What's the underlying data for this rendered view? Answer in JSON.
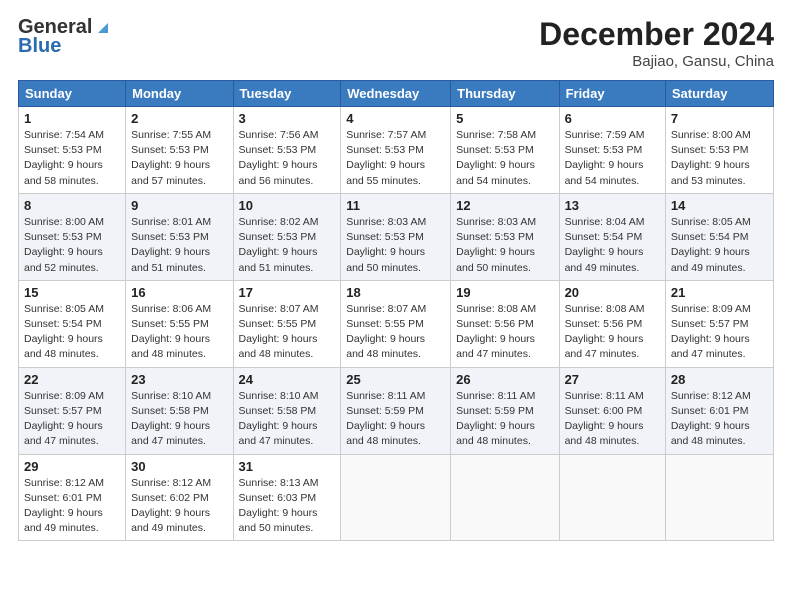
{
  "header": {
    "logo_general": "General",
    "logo_blue": "Blue",
    "month_title": "December 2024",
    "location": "Bajiao, Gansu, China"
  },
  "columns": [
    "Sunday",
    "Monday",
    "Tuesday",
    "Wednesday",
    "Thursday",
    "Friday",
    "Saturday"
  ],
  "weeks": [
    [
      {
        "day": "1",
        "sunrise": "7:54 AM",
        "sunset": "5:53 PM",
        "daylight": "9 hours and 58 minutes."
      },
      {
        "day": "2",
        "sunrise": "7:55 AM",
        "sunset": "5:53 PM",
        "daylight": "9 hours and 57 minutes."
      },
      {
        "day": "3",
        "sunrise": "7:56 AM",
        "sunset": "5:53 PM",
        "daylight": "9 hours and 56 minutes."
      },
      {
        "day": "4",
        "sunrise": "7:57 AM",
        "sunset": "5:53 PM",
        "daylight": "9 hours and 55 minutes."
      },
      {
        "day": "5",
        "sunrise": "7:58 AM",
        "sunset": "5:53 PM",
        "daylight": "9 hours and 54 minutes."
      },
      {
        "day": "6",
        "sunrise": "7:59 AM",
        "sunset": "5:53 PM",
        "daylight": "9 hours and 54 minutes."
      },
      {
        "day": "7",
        "sunrise": "8:00 AM",
        "sunset": "5:53 PM",
        "daylight": "9 hours and 53 minutes."
      }
    ],
    [
      {
        "day": "8",
        "sunrise": "8:00 AM",
        "sunset": "5:53 PM",
        "daylight": "9 hours and 52 minutes."
      },
      {
        "day": "9",
        "sunrise": "8:01 AM",
        "sunset": "5:53 PM",
        "daylight": "9 hours and 51 minutes."
      },
      {
        "day": "10",
        "sunrise": "8:02 AM",
        "sunset": "5:53 PM",
        "daylight": "9 hours and 51 minutes."
      },
      {
        "day": "11",
        "sunrise": "8:03 AM",
        "sunset": "5:53 PM",
        "daylight": "9 hours and 50 minutes."
      },
      {
        "day": "12",
        "sunrise": "8:03 AM",
        "sunset": "5:53 PM",
        "daylight": "9 hours and 50 minutes."
      },
      {
        "day": "13",
        "sunrise": "8:04 AM",
        "sunset": "5:54 PM",
        "daylight": "9 hours and 49 minutes."
      },
      {
        "day": "14",
        "sunrise": "8:05 AM",
        "sunset": "5:54 PM",
        "daylight": "9 hours and 49 minutes."
      }
    ],
    [
      {
        "day": "15",
        "sunrise": "8:05 AM",
        "sunset": "5:54 PM",
        "daylight": "9 hours and 48 minutes."
      },
      {
        "day": "16",
        "sunrise": "8:06 AM",
        "sunset": "5:55 PM",
        "daylight": "9 hours and 48 minutes."
      },
      {
        "day": "17",
        "sunrise": "8:07 AM",
        "sunset": "5:55 PM",
        "daylight": "9 hours and 48 minutes."
      },
      {
        "day": "18",
        "sunrise": "8:07 AM",
        "sunset": "5:55 PM",
        "daylight": "9 hours and 48 minutes."
      },
      {
        "day": "19",
        "sunrise": "8:08 AM",
        "sunset": "5:56 PM",
        "daylight": "9 hours and 47 minutes."
      },
      {
        "day": "20",
        "sunrise": "8:08 AM",
        "sunset": "5:56 PM",
        "daylight": "9 hours and 47 minutes."
      },
      {
        "day": "21",
        "sunrise": "8:09 AM",
        "sunset": "5:57 PM",
        "daylight": "9 hours and 47 minutes."
      }
    ],
    [
      {
        "day": "22",
        "sunrise": "8:09 AM",
        "sunset": "5:57 PM",
        "daylight": "9 hours and 47 minutes."
      },
      {
        "day": "23",
        "sunrise": "8:10 AM",
        "sunset": "5:58 PM",
        "daylight": "9 hours and 47 minutes."
      },
      {
        "day": "24",
        "sunrise": "8:10 AM",
        "sunset": "5:58 PM",
        "daylight": "9 hours and 47 minutes."
      },
      {
        "day": "25",
        "sunrise": "8:11 AM",
        "sunset": "5:59 PM",
        "daylight": "9 hours and 48 minutes."
      },
      {
        "day": "26",
        "sunrise": "8:11 AM",
        "sunset": "5:59 PM",
        "daylight": "9 hours and 48 minutes."
      },
      {
        "day": "27",
        "sunrise": "8:11 AM",
        "sunset": "6:00 PM",
        "daylight": "9 hours and 48 minutes."
      },
      {
        "day": "28",
        "sunrise": "8:12 AM",
        "sunset": "6:01 PM",
        "daylight": "9 hours and 48 minutes."
      }
    ],
    [
      {
        "day": "29",
        "sunrise": "8:12 AM",
        "sunset": "6:01 PM",
        "daylight": "9 hours and 49 minutes."
      },
      {
        "day": "30",
        "sunrise": "8:12 AM",
        "sunset": "6:02 PM",
        "daylight": "9 hours and 49 minutes."
      },
      {
        "day": "31",
        "sunrise": "8:13 AM",
        "sunset": "6:03 PM",
        "daylight": "9 hours and 50 minutes."
      },
      null,
      null,
      null,
      null
    ]
  ]
}
